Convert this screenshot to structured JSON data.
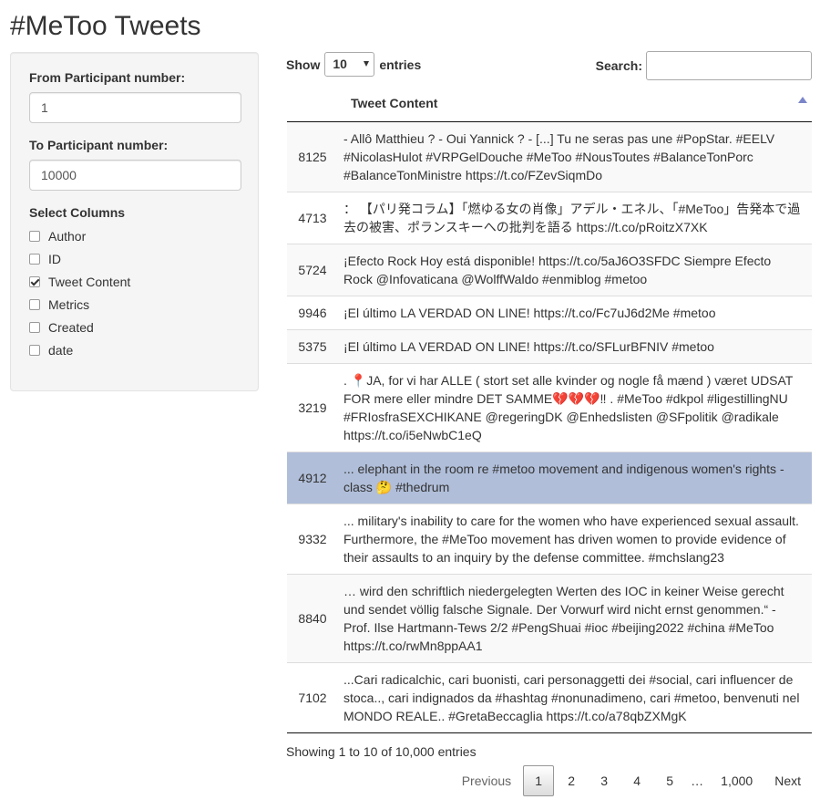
{
  "page_title": "#MeToo Tweets",
  "sidebar": {
    "from_label": "From Participant number:",
    "from_value": "1",
    "to_label": "To Participant number:",
    "to_value": "10000",
    "columns_label": "Select Columns",
    "columns": [
      {
        "label": "Author",
        "checked": false
      },
      {
        "label": "ID",
        "checked": false
      },
      {
        "label": "Tweet Content",
        "checked": true
      },
      {
        "label": "Metrics",
        "checked": false
      },
      {
        "label": "Created",
        "checked": false
      },
      {
        "label": "date",
        "checked": false
      }
    ]
  },
  "table_controls": {
    "show_label": "Show",
    "length_value": "10",
    "entries_label": "entries",
    "search_label": "Search:",
    "search_value": ""
  },
  "table": {
    "header_id": "",
    "header_content": "Tweet Content",
    "rows": [
      {
        "id": "8125",
        "text": "- Allô Matthieu ? - Oui Yannick ? - [...] Tu ne seras pas une #PopStar. #EELV #NicolasHulot #VRPGelDouche #MeToo #NousToutes #BalanceTonPorc #BalanceTonMinistre https://t.co/FZevSiqmDo"
      },
      {
        "id": "4713",
        "text": "： 【パリ発コラム】「燃ゆる女の肖像」アデル・エネル、「#MeToo」告発本で過去の被害、ポランスキーへの批判を語る https://t.co/pRoitzX7XK"
      },
      {
        "id": "5724",
        "text": "¡Efecto Rock Hoy está disponible! https://t.co/5aJ6O3SFDC Siempre Efecto Rock @Infovaticana @WolffWaldo #enmiblog #metoo"
      },
      {
        "id": "9946",
        "text": "¡El último LA VERDAD ON LINE! https://t.co/Fc7uJ6d2Me #metoo"
      },
      {
        "id": "5375",
        "text": "¡El último LA VERDAD ON LINE! https://t.co/SFLurBFNIV #metoo"
      },
      {
        "id": "3219",
        "text": ". 📍JA, for vi har ALLE ( stort set alle kvinder og nogle få mænd ) været UDSAT FOR mere eller mindre DET SAMME💔💔💔‼ . #MeToo #dkpol #ligestillingNU #FRIosfraSEXCHIKANE @regeringDK @Enhedslisten @SFpolitik @radikale https://t.co/i5eNwbC1eQ"
      },
      {
        "id": "4912",
        "text": "... elephant in the room re #metoo movement and indigenous women's rights - class 🤔 #thedrum"
      },
      {
        "id": "9332",
        "text": "... military's inability to care for the women who have experienced sexual assault. Furthermore, the #MeToo movement has driven women to provide evidence of their assaults to an inquiry by the defense committee. #mchslang23"
      },
      {
        "id": "8840",
        "text": "… wird den schriftlich niedergelegten Werten des IOC in keiner Weise gerecht und sendet völlig falsche Signale. Der Vorwurf wird nicht ernst genommen.“ - Prof. Ilse Hartmann-Tews 2/2 #PengShuai #ioc #beijing2022 #china #MeToo https://t.co/rwMn8ppAA1"
      },
      {
        "id": "7102",
        "text": "...Cari radicalchic, cari buonisti, cari personaggetti dei #social, cari influencer de stoca.., cari indignados da #hashtag #nonunadimeno, cari #metoo, benvenuti nel MONDO REALE.. #GretaBeccaglia https://t.co/a78qbZXMgK"
      }
    ],
    "selected_row": 6
  },
  "info_text": "Showing 1 to 10 of 10,000 entries",
  "pagination": {
    "previous": "Previous",
    "pages": [
      "1",
      "2",
      "3",
      "4",
      "5"
    ],
    "ellipsis": "…",
    "last": "1,000",
    "next": "Next",
    "current": "1"
  },
  "colors": {
    "selected_row": "#b0bed9",
    "sort_arrow": "#7a86c8"
  }
}
